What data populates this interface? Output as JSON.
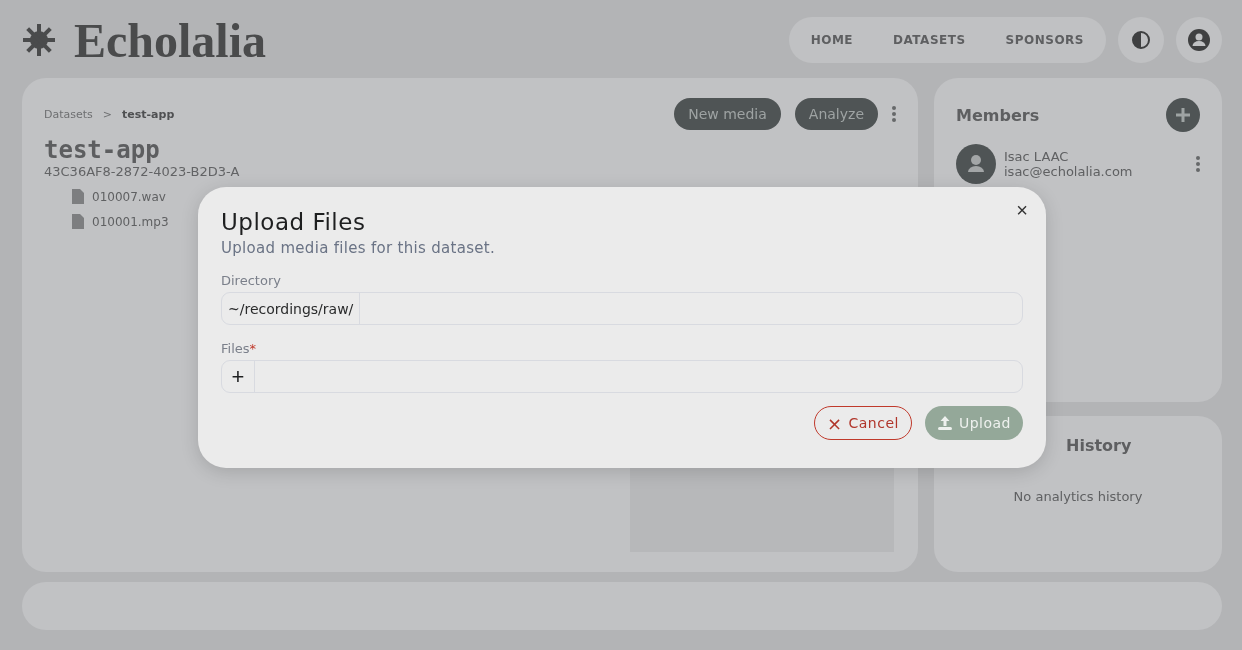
{
  "header": {
    "logo": "Echolalia",
    "nav": [
      "HOME",
      "DATASETS",
      "SPONSORS"
    ]
  },
  "dataset": {
    "breadcrumb": [
      "Datasets",
      "test-app"
    ],
    "separator": ">",
    "title": "test-app",
    "id": "43C36AF8-2872-4023-B2D3-A",
    "actions": [
      "New media",
      "Analyze"
    ],
    "files": [
      "010007.wav",
      "010001.mp3"
    ]
  },
  "members": {
    "title": "Members",
    "list": [
      {
        "name": "Isac LAAC",
        "email": "isac@echolalia.com"
      }
    ]
  },
  "history": {
    "title": "History",
    "empty": "No analytics history"
  },
  "dialog": {
    "title": "Upload Files",
    "subtitle": "Upload media files for this dataset.",
    "directory": {
      "label": "Directory",
      "prefix": "~/recordings/raw/"
    },
    "files": {
      "label": "Files",
      "required": true,
      "required_mark": "*",
      "add": "+"
    },
    "close": "×",
    "buttons": [
      {
        "kind": "cancel",
        "label": "Cancel",
        "icon": "×",
        "disabled": false
      },
      {
        "kind": "upload",
        "label": "Upload",
        "disabled": true
      }
    ]
  }
}
